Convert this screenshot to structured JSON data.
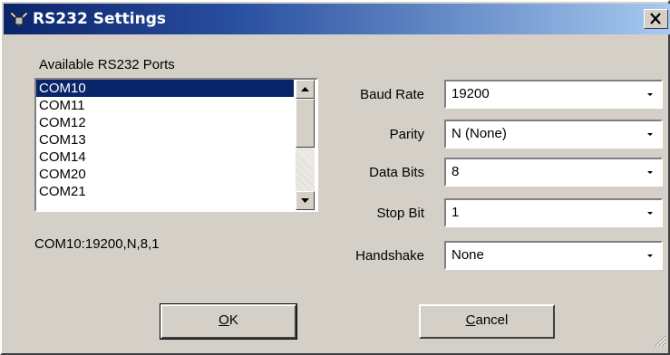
{
  "window": {
    "title": "RS232 Settings",
    "icon": "rs232-plug-icon"
  },
  "ports": {
    "label": "Available RS232 Ports",
    "items": [
      "COM10",
      "COM11",
      "COM12",
      "COM13",
      "COM14",
      "COM20",
      "COM21"
    ],
    "selected": "COM10"
  },
  "summary": "COM10:19200,N,8,1",
  "settings": {
    "baud_rate": {
      "label": "Baud Rate",
      "value": "19200"
    },
    "parity": {
      "label": "Parity",
      "value": "N (None)"
    },
    "data_bits": {
      "label": "Data Bits",
      "value": "8"
    },
    "stop_bit": {
      "label": "Stop Bit",
      "value": "1"
    },
    "handshake": {
      "label": "Handshake",
      "value": "None"
    }
  },
  "buttons": {
    "ok": {
      "mnemonic": "O",
      "rest": "K"
    },
    "cancel": {
      "mnemonic": "C",
      "rest": "ancel"
    }
  },
  "colors": {
    "title_start": "#0a246a",
    "title_end": "#a6caf0",
    "face": "#d4d0c8",
    "selection": "#0a246a"
  }
}
